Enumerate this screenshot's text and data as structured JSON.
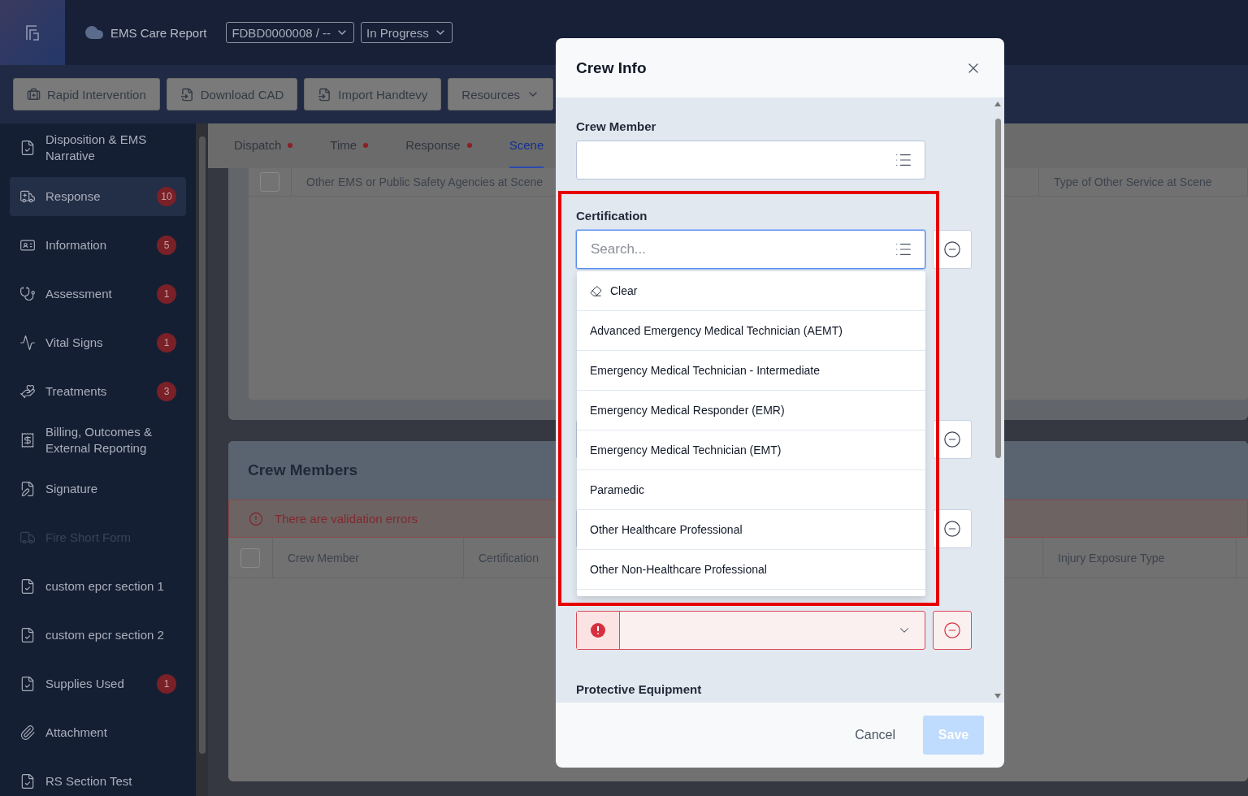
{
  "header": {
    "title": "EMS Care Report",
    "record_select": "FDBD0000008 / --",
    "status_select": "In Progress"
  },
  "toolbar": [
    {
      "label": "Rapid Intervention",
      "kind": "button"
    },
    {
      "label": "Download CAD",
      "kind": "button"
    },
    {
      "label": "Import Handtevy",
      "kind": "button"
    },
    {
      "label": "Resources",
      "kind": "menu"
    }
  ],
  "sidebar": {
    "items": [
      {
        "label": "Disposition & EMS Narrative",
        "selected": false,
        "disabled": false
      },
      {
        "label": "Response",
        "badge": "10",
        "selected": true,
        "disabled": false
      },
      {
        "label": "Information",
        "badge": "5",
        "selected": false,
        "disabled": false
      },
      {
        "label": "Assessment",
        "badge": "1",
        "selected": false,
        "disabled": false
      },
      {
        "label": "Vital Signs",
        "badge": "1",
        "selected": false,
        "disabled": false
      },
      {
        "label": "Treatments",
        "badge": "3",
        "selected": false,
        "disabled": false
      },
      {
        "label": "Billing, Outcomes & External Reporting",
        "selected": false,
        "disabled": false
      },
      {
        "label": "Signature",
        "selected": false,
        "disabled": false
      },
      {
        "label": "Fire Short Form",
        "selected": false,
        "disabled": true
      },
      {
        "label": "custom epcr section 1",
        "selected": false,
        "disabled": false
      },
      {
        "label": "custom epcr section 2",
        "selected": false,
        "disabled": false
      },
      {
        "label": "Supplies Used",
        "badge": "1",
        "selected": false,
        "disabled": false
      },
      {
        "label": "Attachment",
        "selected": false,
        "disabled": false
      },
      {
        "label": "RS Section Test",
        "selected": false,
        "disabled": false
      }
    ]
  },
  "tabs": [
    {
      "label": "Dispatch",
      "selected": false,
      "error": true
    },
    {
      "label": "Time",
      "selected": false,
      "error": true
    },
    {
      "label": "Response",
      "selected": false,
      "error": true
    },
    {
      "label": "Scene",
      "selected": true,
      "error": false
    }
  ],
  "scene_table": {
    "select_all_checked": false,
    "columns": [
      "Other EMS or Public Safety Agencies at Scene",
      "Type of Other Service at Scene"
    ]
  },
  "crew_card": {
    "title": "Crew Members",
    "validation_message": "There are validation errors",
    "select_all_checked": false,
    "columns": [
      "Crew Member",
      "Certification",
      "Injury Exposure Type"
    ]
  },
  "modal": {
    "title": "Crew Info",
    "crew_member": {
      "label": "Crew Member"
    },
    "certification": {
      "label": "Certification",
      "placeholder": "Search...",
      "focused": true
    },
    "dropdown": {
      "clear_label": "Clear",
      "options": [
        "Advanced Emergency Medical Technician (AEMT)",
        "Emergency Medical Technician - Intermediate",
        "Emergency Medical Responder (EMR)",
        "Emergency Medical Technician (EMT)",
        "Paramedic",
        "Other Healthcare Professional",
        "Other Non-Healthcare Professional"
      ]
    },
    "hidden_rows": [
      {
        "kind": "removable"
      },
      {
        "kind": "removable"
      }
    ],
    "crew_cost": {
      "error": true
    },
    "next_section": "Protective Equipment",
    "cancel": "Cancel",
    "save": {
      "label": "Save",
      "disabled": true
    }
  }
}
